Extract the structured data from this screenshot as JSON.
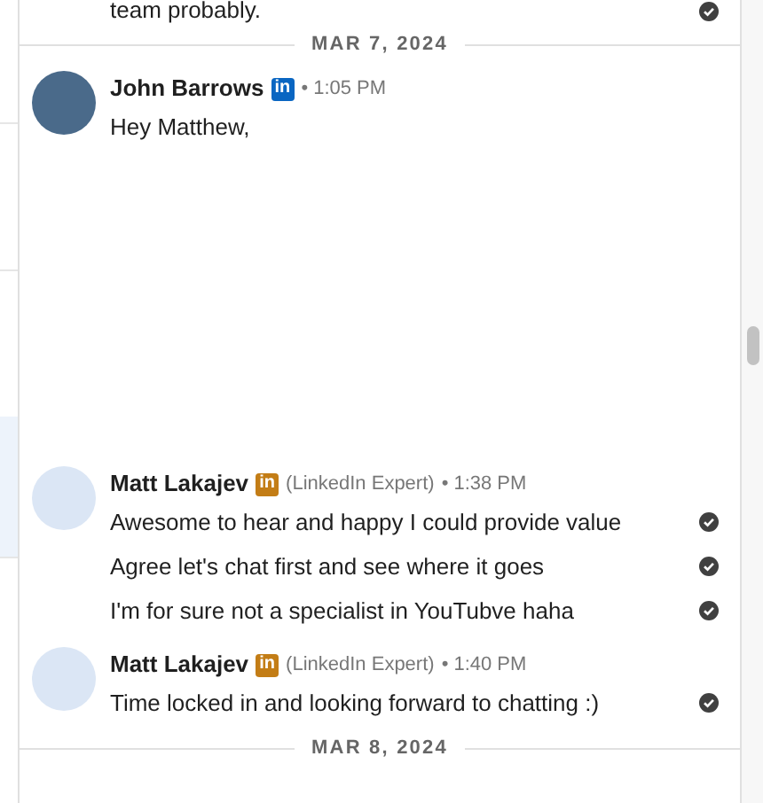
{
  "previous_message": {
    "text": "team probably.",
    "read": true
  },
  "days": [
    {
      "date": "MAR 7, 2024",
      "groups": [
        {
          "sender": "John Barrows",
          "badge": {
            "kind": "linkedin",
            "text": "in"
          },
          "time": "• 1:05 PM",
          "messages": [
            {
              "text": "Hey Matthew,",
              "read": false
            }
          ]
        },
        {
          "sender": "Matt Lakajev",
          "badge": {
            "kind": "premium",
            "text": "in"
          },
          "role": "(LinkedIn Expert)",
          "time": "• 1:38 PM",
          "messages": [
            {
              "text": "Awesome to hear and happy I could provide value",
              "read": true
            },
            {
              "text": "Agree let's chat first and see where it goes",
              "read": true
            },
            {
              "text": "I'm for sure not a specialist in YouTubve haha",
              "read": true
            }
          ]
        },
        {
          "sender": "Matt Lakajev",
          "badge": {
            "kind": "premium",
            "text": "in"
          },
          "role": "(LinkedIn Expert)",
          "time": "• 1:40 PM",
          "messages": [
            {
              "text": "Time locked in and looking forward to chatting :)",
              "read": true
            }
          ]
        }
      ]
    },
    {
      "date": "MAR 8, 2024"
    }
  ]
}
